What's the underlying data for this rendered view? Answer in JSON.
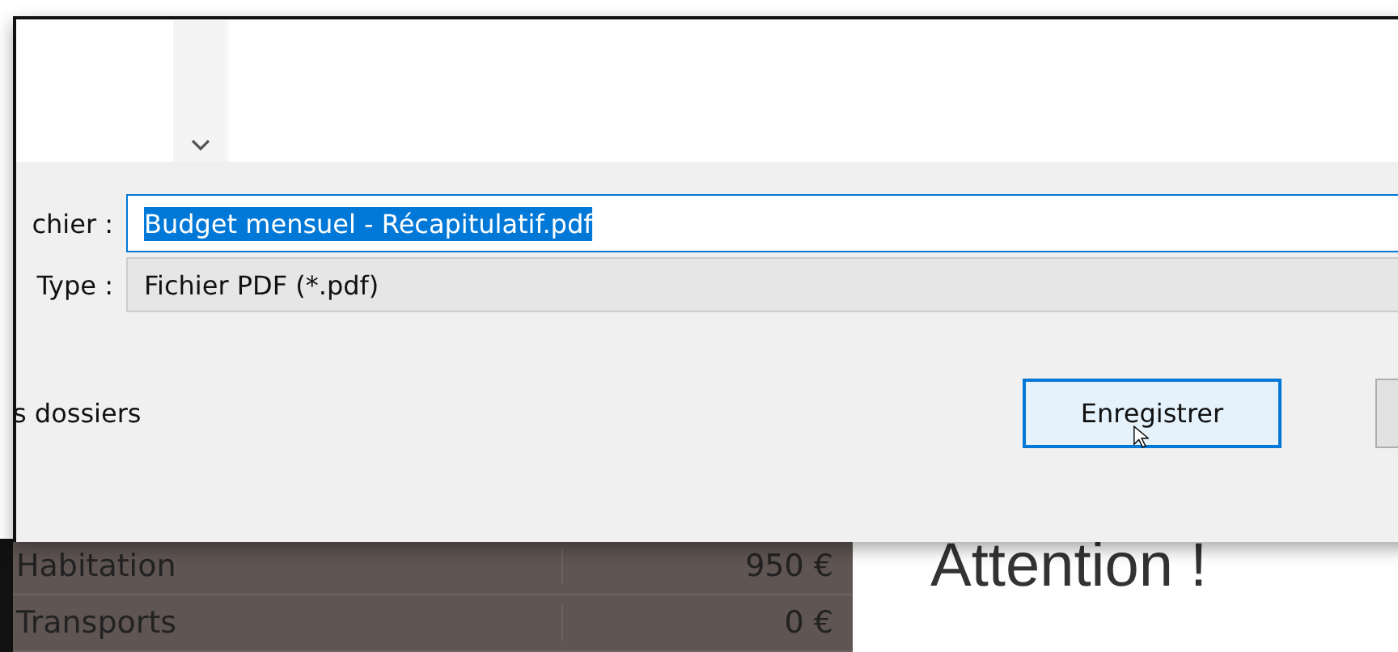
{
  "dialog": {
    "filename_label": "chier :",
    "filename_value": "Budget mensuel - Récapitulatif.pdf",
    "filename_selected": true,
    "type_label": "Type :",
    "type_value": "Fichier PDF (*.pdf)",
    "folders_toggle": "s dossiers",
    "buttons": [
      {
        "label": "Enregistrer",
        "default": true
      },
      {
        "default": false
      }
    ]
  },
  "sheet": {
    "rows": [
      {
        "category": "Habitation",
        "amount": "950 €"
      },
      {
        "category": "Transports",
        "amount": "0 €"
      }
    ]
  },
  "notice": {
    "heading": "Attention !"
  }
}
